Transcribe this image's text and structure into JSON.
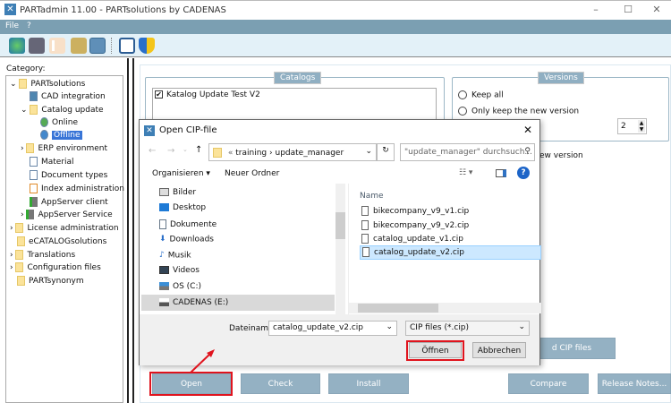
{
  "window": {
    "title": "PARTadmin 11.00 - PARTsolutions by CADENAS",
    "minimize": "–",
    "maximize": "☐",
    "close": "✕"
  },
  "menu": [
    "File",
    "?"
  ],
  "toolbar_icons": [
    "sync-icon",
    "servers-icon",
    "tree-icon",
    "keys-icon",
    "settings-icon",
    "save-icon",
    "shield-icon"
  ],
  "sidebar": {
    "label": "Category:",
    "items": [
      {
        "label": "PARTsolutions",
        "icon": "folder"
      },
      {
        "label": "CAD integration",
        "icon": "cad"
      },
      {
        "label": "Catalog update",
        "icon": "folder"
      },
      {
        "label": "Online",
        "icon": "globe"
      },
      {
        "label": "Offline",
        "icon": "globe",
        "selected": true
      },
      {
        "label": "ERP environment",
        "icon": "folder"
      },
      {
        "label": "Material",
        "icon": "doc"
      },
      {
        "label": "Document types",
        "icon": "doc"
      },
      {
        "label": "Index administration",
        "icon": "tree"
      },
      {
        "label": "AppServer client",
        "icon": "server"
      },
      {
        "label": "AppServer Service",
        "icon": "server"
      },
      {
        "label": "License administration",
        "icon": "folder"
      },
      {
        "label": "eCATALOGsolutions",
        "icon": "folder"
      },
      {
        "label": "Translations",
        "icon": "folder"
      },
      {
        "label": "Configuration files",
        "icon": "folder"
      },
      {
        "label": "PARTsynonym",
        "icon": "folder"
      }
    ]
  },
  "catalogs": {
    "legend": "Catalogs",
    "items": [
      {
        "label": "Katalog Update Test V2",
        "checked": true
      }
    ]
  },
  "versions": {
    "legend": "Versions",
    "keep_all": "Keep all",
    "only_new": "Only keep the new version",
    "count": "2",
    "partial_option": "ew version"
  },
  "buttons": {
    "partial_cip": "d CIP files",
    "open": "Open",
    "check": "Check",
    "install": "Install",
    "compare": "Compare",
    "release_notes": "Release Notes..."
  },
  "dialog": {
    "title": "Open CIP-file",
    "close": "✕",
    "path": [
      "«",
      "training",
      "›",
      "update_manager"
    ],
    "search_placeholder": "\"update_manager\" durchsuch...",
    "organize": "Organisieren ▾",
    "new_folder": "Neuer Ordner",
    "nav": [
      "Bilder",
      "Desktop",
      "Dokumente",
      "Downloads",
      "Musik",
      "Videos",
      "OS (C:)",
      "CADENAS (E:)"
    ],
    "column_name": "Name",
    "files": [
      "bikecompany_v9_v1.cip",
      "bikecompany_v9_v2.cip",
      "catalog_update_v1.cip",
      "catalog_update_v2.cip"
    ],
    "selected_file": "catalog_update_v2.cip",
    "filename_label": "Dateiname:",
    "filename_value": "catalog_update_v2.cip",
    "filter": "CIP files (*.cip)",
    "open": "Öffnen",
    "cancel": "Abbrechen"
  },
  "colors": {
    "menu": "#7b9fb2",
    "button": "#94b1c3",
    "highlight": "#e0141e",
    "selection": "#cce8ff"
  }
}
